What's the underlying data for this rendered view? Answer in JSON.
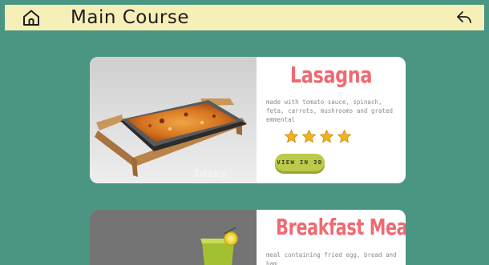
{
  "header": {
    "title": "Main Course",
    "home_icon": "home-icon",
    "back_icon": "back-arrow-icon",
    "background_color": "#f7efb8"
  },
  "page": {
    "background_color": "#4b9683"
  },
  "cards": [
    {
      "name": "Lasagna",
      "description": "made with tomato sauce, spinach, feta, carrots, mushrooms and grated emmental",
      "rating": 4,
      "button_label": "VIEW IN 3D",
      "watermark": "3dsky"
    },
    {
      "name": "Breakfast Meal",
      "description": "meal containing fried egg, bread and ham"
    }
  ],
  "colors": {
    "title_accent": "#ef6a72",
    "button": "#bcc94a",
    "star": "#f3b21d"
  }
}
